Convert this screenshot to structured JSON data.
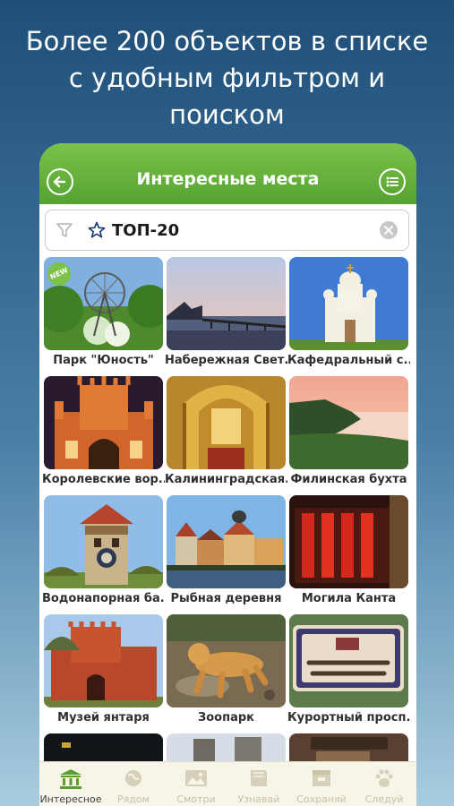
{
  "promo": {
    "line1": "Более 200 объектов в списке",
    "line2": "с удобным фильтром и",
    "line3": "поиском"
  },
  "appbar": {
    "title": "Интересные места"
  },
  "search": {
    "value": "ТОП-20"
  },
  "colors": {
    "brand_green": "#6ab43e",
    "badge_new": "#7cc24a"
  },
  "places": [
    {
      "caption": "Парк \"Юность\"",
      "badge": "NEW"
    },
    {
      "caption": "Набережная Свет..."
    },
    {
      "caption": "Кафедральный с..."
    },
    {
      "caption": "Королевские вор..."
    },
    {
      "caption": "Калининградская..."
    },
    {
      "caption": "Филинская бухта"
    },
    {
      "caption": "Водонапорная ба..."
    },
    {
      "caption": "Рыбная деревня"
    },
    {
      "caption": "Могила Канта"
    },
    {
      "caption": "Музей янтаря"
    },
    {
      "caption": "Зоопарк"
    },
    {
      "caption": "Курортный просп..."
    }
  ],
  "bottom_nav": [
    {
      "label": "Интересное",
      "icon": "museum-icon",
      "active": true
    },
    {
      "label": "Рядом",
      "icon": "globe-icon"
    },
    {
      "label": "Смотри",
      "icon": "picture-icon"
    },
    {
      "label": "Узнавай",
      "icon": "book-icon"
    },
    {
      "label": "Сохраняй",
      "icon": "save-box-icon"
    },
    {
      "label": "Следуй",
      "icon": "paw-icon"
    }
  ]
}
